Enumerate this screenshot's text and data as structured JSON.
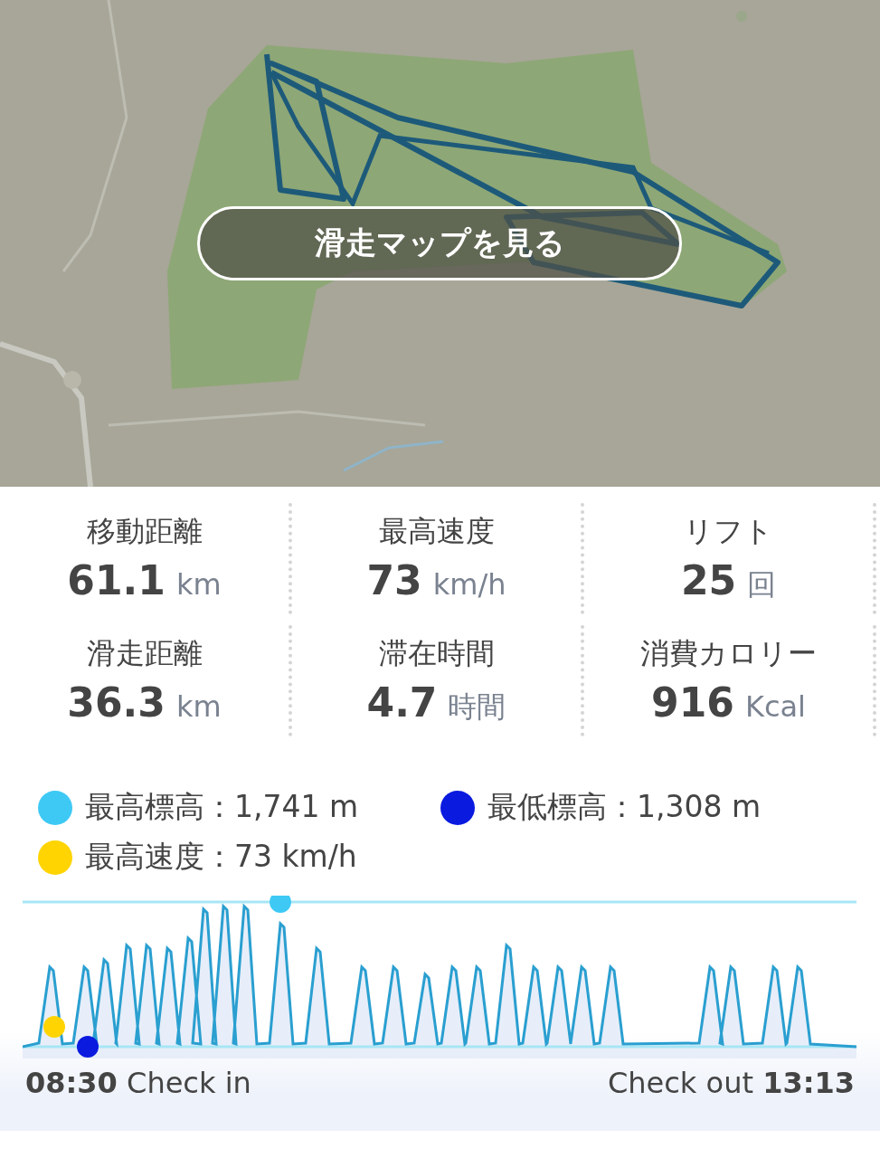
{
  "map": {
    "button": "滑走マップを見る"
  },
  "stats": [
    {
      "label": "移動距離",
      "value": "61.1",
      "unit": "km"
    },
    {
      "label": "最高速度",
      "value": "73",
      "unit": "km/h"
    },
    {
      "label": "リフト",
      "value": "25",
      "unit": "回"
    },
    {
      "label": "滑走距離",
      "value": "36.3",
      "unit": "km"
    },
    {
      "label": "滞在時間",
      "value": "4.7",
      "unit": "時間"
    },
    {
      "label": "消費カロリー",
      "value": "916",
      "unit": "Kcal"
    }
  ],
  "legend": [
    {
      "label": "最高標高：1,741 m",
      "color": "#3ec9f5"
    },
    {
      "label": "最低標高：1,308 m",
      "color": "#0a1adf"
    },
    {
      "label": "最高速度：73 km/h",
      "color": "#ffd400"
    }
  ],
  "chart": {
    "check_in": "**08:30** Check in",
    "check_out": "Check out **13:13**"
  }
}
